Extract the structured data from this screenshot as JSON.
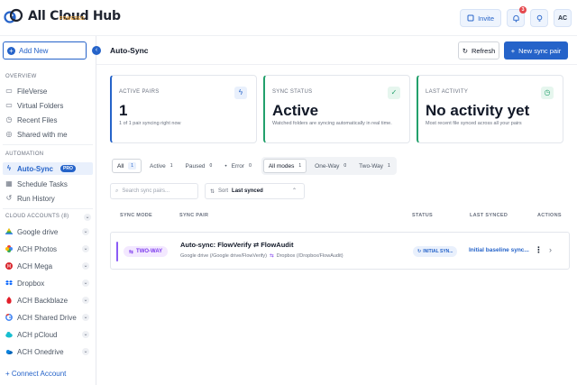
{
  "app": {
    "logo_text": "All Cloud Hub",
    "logo_subtext": "POWERED",
    "invite_label": "Invite",
    "notification_count": "3",
    "avatar_initials": "AC",
    "brand_color": "#2563c9"
  },
  "sidebar": {
    "add_new_label": "Add New",
    "overview_header": "OVERVIEW",
    "overview_items": [
      {
        "label": "FileVerse",
        "icon": "folder-icon"
      },
      {
        "label": "Virtual Folders",
        "icon": "folder-icon"
      },
      {
        "label": "Recent Files",
        "icon": "clock-icon"
      },
      {
        "label": "Shared with me",
        "icon": "share-icon"
      }
    ],
    "automation_header": "AUTOMATION",
    "automation_items": [
      {
        "label": "Auto-Sync",
        "icon": "bolt-icon",
        "badge": "PRO",
        "active": true
      },
      {
        "label": "Schedule Tasks",
        "icon": "calendar-icon"
      },
      {
        "label": "Run History",
        "icon": "history-icon"
      }
    ],
    "cloud_header": "CLOUD ACCOUNTS (8)",
    "cloud_items": [
      {
        "label": "Google drive",
        "icon": "google-drive-icon"
      },
      {
        "label": "ACH Photos",
        "icon": "google-photos-icon"
      },
      {
        "label": "ACH Mega",
        "icon": "mega-icon"
      },
      {
        "label": "Dropbox",
        "icon": "dropbox-icon"
      },
      {
        "label": "ACH Backblaze",
        "icon": "backblaze-icon"
      },
      {
        "label": "ACH Shared Drive",
        "icon": "google-icon"
      },
      {
        "label": "ACH pCloud",
        "icon": "pcloud-icon"
      },
      {
        "label": "ACH Onedrive",
        "icon": "onedrive-icon"
      }
    ],
    "connect_label": "Connect Account"
  },
  "header": {
    "title": "Auto-Sync",
    "refresh_label": "Refresh",
    "new_pair_label": "New sync pair"
  },
  "cards": [
    {
      "label": "ACTIVE PAIRS",
      "value": "1",
      "desc": "1 of 1 pair syncing right now",
      "icon": "bolt-icon",
      "color": "#2563c9"
    },
    {
      "label": "SYNC STATUS",
      "value": "Active",
      "desc": "Watched folders are syncing automatically in real time.",
      "icon": "check-icon",
      "color": "#22a06b"
    },
    {
      "label": "LAST ACTIVITY",
      "value": "No activity yet",
      "desc": "Most recent file synced across all your pairs",
      "icon": "clock-icon",
      "color": "#22a06b"
    }
  ],
  "filters": {
    "status": [
      {
        "label": "All",
        "count": "1"
      },
      {
        "label": "Active",
        "count": "1"
      },
      {
        "label": "Paused",
        "count": "0"
      },
      {
        "label": "Error",
        "count": "0"
      }
    ],
    "modes": [
      {
        "label": "All modes",
        "count": "1"
      },
      {
        "label": "One-Way",
        "count": "0"
      },
      {
        "label": "Two-Way",
        "count": "1"
      }
    ]
  },
  "search": {
    "placeholder": "Search sync pairs..."
  },
  "sort": {
    "label": "Sort",
    "value": "Last synced"
  },
  "table": {
    "headers": {
      "mode": "SYNC MODE",
      "pair": "SYNC PAIR",
      "status": "STATUS",
      "last": "LAST SYNCED",
      "actions": "ACTIONS"
    },
    "rows": [
      {
        "mode": "TWO-WAY",
        "title": "Auto-sync: FlowVerify ⇄ FlowAudit",
        "source": "Google drive (/Google drive/FlowVerify)",
        "target": "Dropbox (/Dropbox/FlowAudit)",
        "status": "INITIAL SYN...",
        "last_synced": "Initial baseline sync..."
      }
    ]
  }
}
